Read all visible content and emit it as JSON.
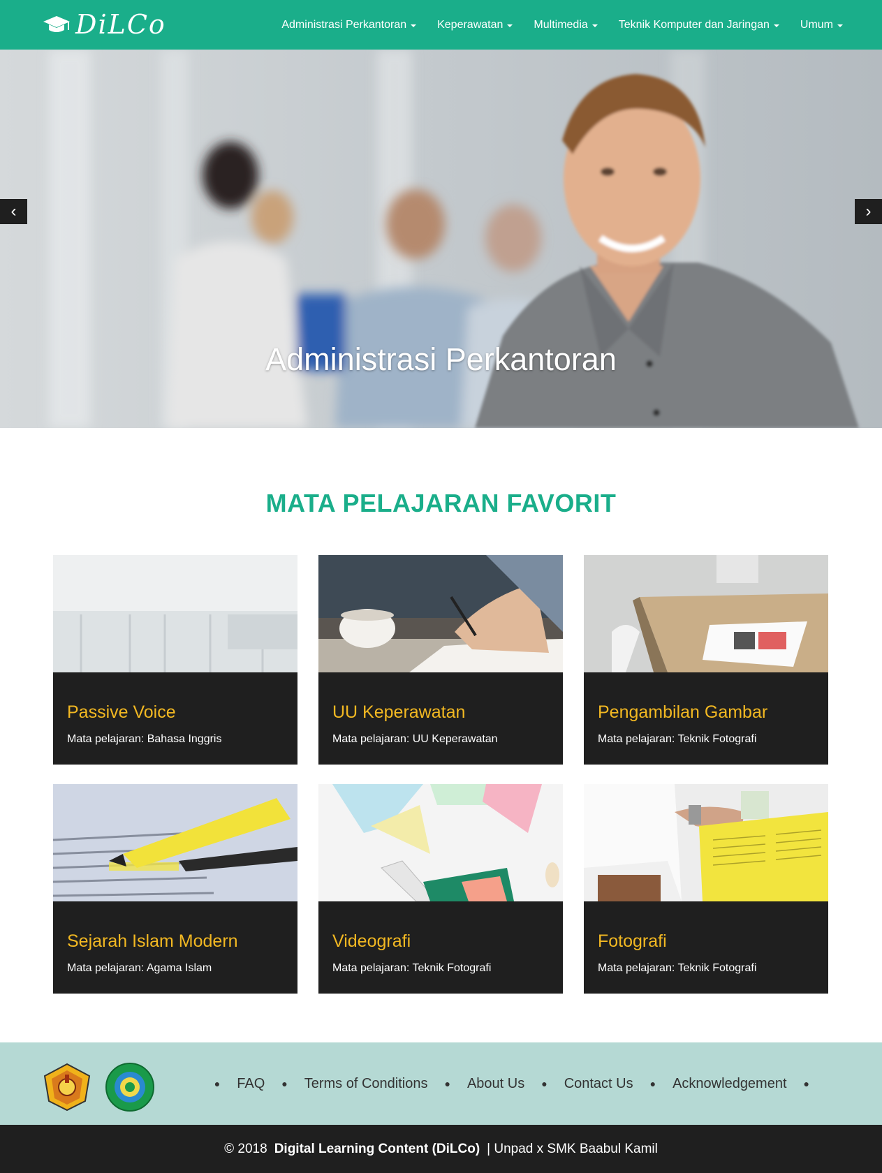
{
  "brand": {
    "name": "DiLCo",
    "icon": "graduation-cap-icon"
  },
  "nav": {
    "items": [
      {
        "label": "Administrasi Perkantoran"
      },
      {
        "label": "Keperawatan"
      },
      {
        "label": "Multimedia"
      },
      {
        "label": "Teknik Komputer dan Jaringan"
      },
      {
        "label": "Umum"
      }
    ]
  },
  "hero": {
    "caption": "Administrasi Perkantoran",
    "prev_label": "‹",
    "next_label": "›"
  },
  "section": {
    "title": "MATA PELAJARAN FAVORIT"
  },
  "cards": [
    {
      "title": "Passive Voice",
      "subtitle": "Mata pelajaran: Bahasa Inggris"
    },
    {
      "title": "UU Keperawatan",
      "subtitle": "Mata pelajaran: UU Keperawatan"
    },
    {
      "title": "Pengambilan Gambar",
      "subtitle": "Mata pelajaran: Teknik Fotografi"
    },
    {
      "title": "Sejarah Islam Modern",
      "subtitle": "Mata pelajaran: Agama Islam"
    },
    {
      "title": "Videografi",
      "subtitle": "Mata pelajaran: Teknik Fotografi"
    },
    {
      "title": "Fotografi",
      "subtitle": "Mata pelajaran: Teknik Fotografi"
    }
  ],
  "footer": {
    "links": [
      {
        "label": "FAQ"
      },
      {
        "label": "Terms of Conditions"
      },
      {
        "label": "About Us"
      },
      {
        "label": "Contact Us"
      },
      {
        "label": "Acknowledgement"
      }
    ],
    "bullet": "●",
    "copyright_prefix": "© 2018",
    "copyright_bold": "Digital Learning Content (DiLCo)",
    "copyright_suffix": "| Unpad x SMK Baabul Kamil"
  },
  "colors": {
    "primary": "#1aae8a",
    "card_title": "#f2b822",
    "card_bg": "#1f1f1f",
    "footer_bg": "#b5d9d4"
  }
}
